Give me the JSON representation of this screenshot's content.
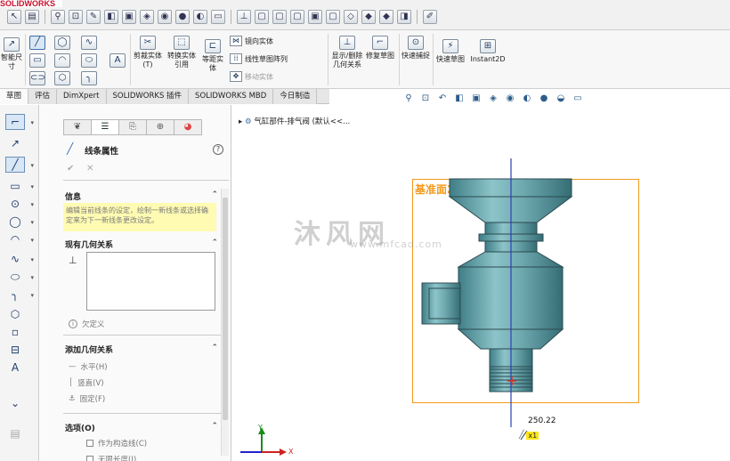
{
  "app": {
    "logo": "SOLIDWORKS"
  },
  "ribbon": {
    "smart_dimension": "智能尺寸",
    "trim_entities": "剪裁实体(T)",
    "convert_entities": "转换实体引用",
    "offset_entities": "等距实体",
    "mirror_entities": "镜向实体",
    "linear_pattern": "线性草图阵列",
    "move_entities": "移动实体",
    "display_relations": "显示/删除几何关系",
    "repair_sketch": "修复草图",
    "quick_snaps": "快速捕捉",
    "rapid_sketch": "快速草图",
    "instant2d": "Instant2D"
  },
  "tabs": [
    "草图",
    "评估",
    "DimXpert",
    "SOLIDWORKS 插件",
    "SOLIDWORKS MBD",
    "今日制造"
  ],
  "panel": {
    "title": "线条属性",
    "info_header": "信息",
    "info_text": "编辑当前线条的设定，绘制一新线条或选择确定来为下一新线条更改设定。",
    "existing_relations_header": "现有几何关系",
    "under_defined": "欠定义",
    "add_relations_header": "添加几何关系",
    "horizontal": "水平(H)",
    "vertical": "竖直(V)",
    "fix": "固定(F)",
    "options_header": "选项(O)",
    "construction": "作为构造线(C)",
    "infinite_length": "无限长度(I)"
  },
  "graphics": {
    "tree_label": "气缸部件-排气阀 (默认<<...",
    "plane_label": "基准面2",
    "dimension_value": "250.22",
    "selection_badge": "x1",
    "watermark": "沐风网",
    "watermark_url": "www.mfcad.com",
    "triad_y": "Y",
    "triad_x": "X"
  },
  "colors": {
    "part": "#6fa9b0",
    "plane": "#f39a1c",
    "axis": "#2d3fb3",
    "badge": "#ffe51a"
  }
}
